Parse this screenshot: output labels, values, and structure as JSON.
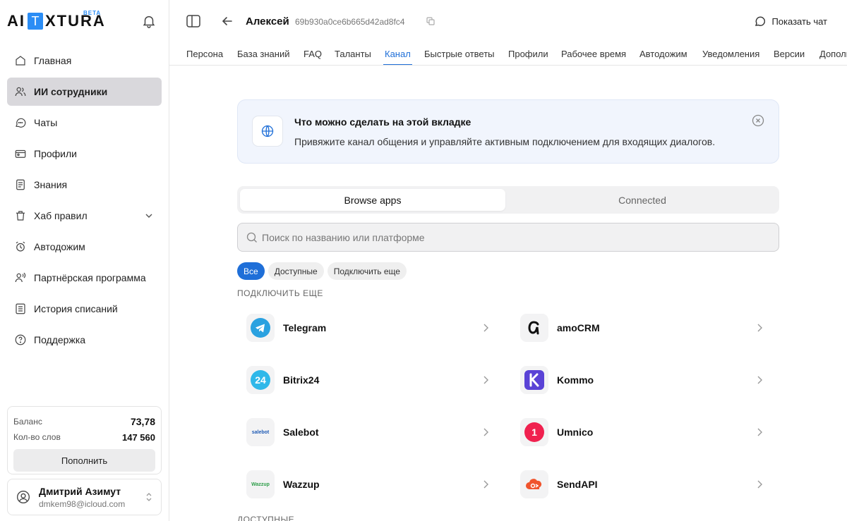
{
  "sidebar": {
    "logo_left": "AI",
    "logo_box": "T",
    "logo_right": "XTURA",
    "logo_beta": "BETA",
    "items": [
      {
        "label": "Главная"
      },
      {
        "label": "ИИ сотрудники"
      },
      {
        "label": "Чаты"
      },
      {
        "label": "Профили"
      },
      {
        "label": "Знания"
      },
      {
        "label": "Хаб правил"
      },
      {
        "label": "Автодожим"
      },
      {
        "label": "Партнёрская программа"
      },
      {
        "label": "История списаний"
      },
      {
        "label": "Поддержка"
      }
    ],
    "balance_label": "Баланс",
    "balance_value": "73,78",
    "words_label": "Кол-во слов",
    "words_value": "147 560",
    "topup_label": "Пополнить",
    "user_name": "Дмитрий Азимут",
    "user_email": "dmkem98@icloud.com"
  },
  "header": {
    "agent_name": "Алексей",
    "agent_id": "69b930a0ce6b665d42ad8fc4",
    "show_chat": "Показать чат"
  },
  "tabs": [
    "Персона",
    "База знаний",
    "FAQ",
    "Таланты",
    "Канал",
    "Быстрые ответы",
    "Профили",
    "Рабочее время",
    "Автодожим",
    "Уведомления",
    "Версии",
    "Дополн"
  ],
  "info": {
    "title": "Что можно сделать на этой вкладке",
    "text": "Привяжите канал общения и управляйте активным подключением для входящих диалогов."
  },
  "segment": {
    "browse": "Browse apps",
    "connected": "Connected"
  },
  "search": {
    "placeholder": "Поиск по названию или платформе"
  },
  "chips": [
    "Все",
    "Доступные",
    "Подключить еще"
  ],
  "section_connect_more": "ПОДКЛЮЧИТЬ ЕЩЕ",
  "section_available": "ДОСТУПНЫЕ",
  "apps": [
    {
      "name": "Telegram",
      "icon": "telegram-icon"
    },
    {
      "name": "amoCRM",
      "icon": "amocrm-icon"
    },
    {
      "name": "Bitrix24",
      "icon": "bitrix24-icon"
    },
    {
      "name": "Kommo",
      "icon": "kommo-icon"
    },
    {
      "name": "Salebot",
      "icon": "salebot-icon",
      "icon_text": "salebot"
    },
    {
      "name": "Umnico",
      "icon": "umnico-icon",
      "icon_text": "1"
    },
    {
      "name": "Wazzup",
      "icon": "wazzup-icon",
      "icon_text": "Wazzup"
    },
    {
      "name": "SendAPI",
      "icon": "sendapi-icon"
    }
  ],
  "colors": {
    "accent": "#1f6fd8",
    "logo_blue": "#2b8df5",
    "active_nav": "#d9d8dc"
  }
}
